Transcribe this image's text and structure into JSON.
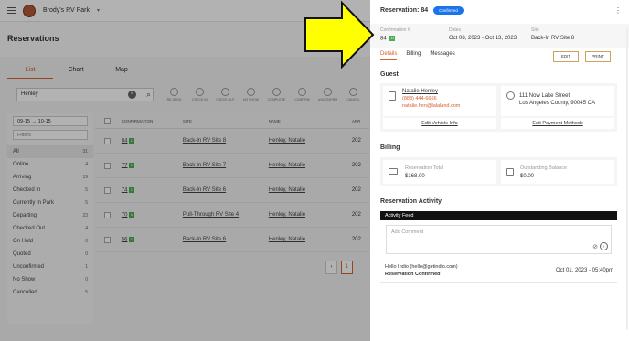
{
  "app": {
    "park_name": "Brody's RV Park",
    "page_title": "Reservations"
  },
  "view_tabs": [
    "List",
    "Chart",
    "Map"
  ],
  "search": {
    "value": "Henley"
  },
  "actions": [
    "RE-SEND",
    "CHECK IN",
    "CHECK OUT",
    "NO SHOW",
    "COMPLETE",
    "CONFIRM",
    "UNCONFIRM",
    "CANCEL"
  ],
  "date_range": {
    "from": "09-15",
    "arrow": "→",
    "to": "10-15"
  },
  "filters_placeholder": "Filters",
  "status_filters": [
    {
      "label": "All",
      "count": "31"
    },
    {
      "label": "Online",
      "count": "4"
    },
    {
      "label": "Arriving",
      "count": "19"
    },
    {
      "label": "Checked In",
      "count": "5"
    },
    {
      "label": "Currently In Park",
      "count": "5"
    },
    {
      "label": "Departing",
      "count": "23"
    },
    {
      "label": "Checked Out",
      "count": "4"
    },
    {
      "label": "On Hold",
      "count": "0"
    },
    {
      "label": "Quoted",
      "count": "0"
    },
    {
      "label": "Unconfirmed",
      "count": "1"
    },
    {
      "label": "No Show",
      "count": "0"
    },
    {
      "label": "Cancelled",
      "count": "5"
    }
  ],
  "table": {
    "headers": {
      "confirmation": "CONFIRMATION",
      "site": "SITE",
      "name": "NAME",
      "arrival": "ARR"
    },
    "rows": [
      {
        "conf": "84",
        "badge": "D",
        "site": "Back-In RV Site 8",
        "name": "Henley, Natalie",
        "arr": "202"
      },
      {
        "conf": "77",
        "badge": "D",
        "site": "Back-In RV Site 7",
        "name": "Henley, Natalie",
        "arr": "202"
      },
      {
        "conf": "74",
        "badge": "D",
        "site": "Back-In RV Site 6",
        "name": "Henley, Natalie",
        "arr": "202"
      },
      {
        "conf": "70",
        "badge": "M",
        "site": "Pull-Through RV Site 4",
        "name": "Henley, Natalie",
        "arr": "202"
      },
      {
        "conf": "56",
        "badge": "D",
        "site": "Back-In RV Site 6",
        "name": "Henley, Natalie",
        "arr": "202"
      }
    ]
  },
  "pager": {
    "prev": "‹",
    "current": "1"
  },
  "drawer": {
    "title": "Reservation: 84",
    "status": "Confirmed",
    "more": "⋮",
    "confirmation_label": "Confirmation #",
    "confirmation_value": "84",
    "confirmation_badge": "D",
    "dates_label": "Dates",
    "dates_value": "Oct 08, 2023 - Oct 13, 2023",
    "site_label": "Site",
    "site_value": "Back-In RV Site 8",
    "tabs": [
      "Details",
      "Billing",
      "Messages"
    ],
    "edit_label": "EDIT",
    "print_label": "PRINT",
    "guest_section": "Guest",
    "guest": {
      "name": "Natalie Henley",
      "phone": "(888) 444-6666",
      "email": "natalie.hen@lalaland.com",
      "address_line1": "111 Now Lake Street",
      "address_line2": "Los Angeles County, 90045 CA",
      "edit_vehicle": "Edit Vehicle Info",
      "edit_payment": "Edit Payment Methods"
    },
    "billing_section": "Billing",
    "billing": {
      "total_label": "Reservation Total",
      "total_value": "$168.00",
      "balance_label": "Outstanding Balance",
      "balance_value": "$0.00"
    },
    "activity_section": "Reservation Activity",
    "feed_title": "Activity Feed",
    "comment_placeholder": "Add Comment",
    "entry": {
      "who": "Hello Indio (hello@getindio.com)",
      "what": "Reservation Confirmed",
      "when": "Oct 01, 2023 - 05:40pm"
    }
  },
  "colors": {
    "accent": "#d3622f",
    "confirmed_badge": "#1a73e8",
    "arrow_fill": "#ffff00",
    "site_badge": "#4caf50"
  }
}
